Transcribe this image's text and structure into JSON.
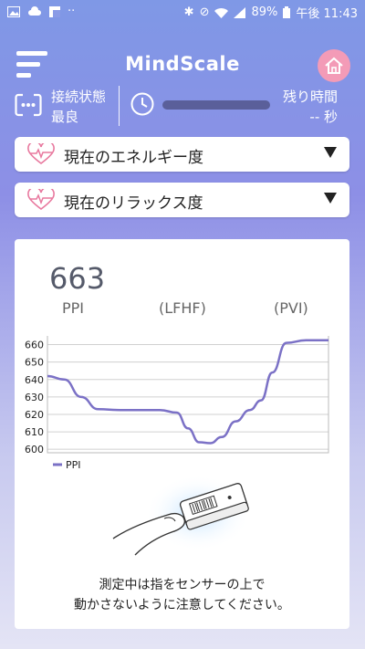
{
  "status_bar": {
    "battery": "89%",
    "time": "午後 11:43",
    "dots": "··"
  },
  "header": {
    "title": "MindScale"
  },
  "connection": {
    "label": "接続状態",
    "value": "最良"
  },
  "remaining": {
    "label": "残り時間",
    "value": "-- 秒"
  },
  "dropdowns": [
    {
      "label": "現在のエネルギー度"
    },
    {
      "label": "現在のリラックス度"
    }
  ],
  "card": {
    "value": "663",
    "labels": [
      "PPI",
      "(LFHF)",
      "(PVI)"
    ],
    "hint_line1": "測定中は指をセンサーの上で",
    "hint_line2": "動かさないように注意してください。"
  },
  "chart_data": {
    "type": "line",
    "yticks": [
      660,
      650,
      640,
      630,
      620,
      610,
      600
    ],
    "ylim": [
      598,
      665
    ],
    "legend": "PPI",
    "color": "#7b71c6",
    "series": [
      {
        "name": "PPI",
        "points": [
          [
            0,
            642
          ],
          [
            6,
            640
          ],
          [
            12,
            630
          ],
          [
            18,
            623
          ],
          [
            26,
            622.5
          ],
          [
            40,
            622.5
          ],
          [
            46,
            621
          ],
          [
            50,
            612
          ],
          [
            54,
            604
          ],
          [
            58,
            603.5
          ],
          [
            62,
            607
          ],
          [
            67,
            616
          ],
          [
            72,
            622.5
          ],
          [
            76,
            628
          ],
          [
            80,
            644
          ],
          [
            85,
            661
          ],
          [
            92,
            662.5
          ],
          [
            100,
            662.5
          ]
        ]
      }
    ]
  }
}
